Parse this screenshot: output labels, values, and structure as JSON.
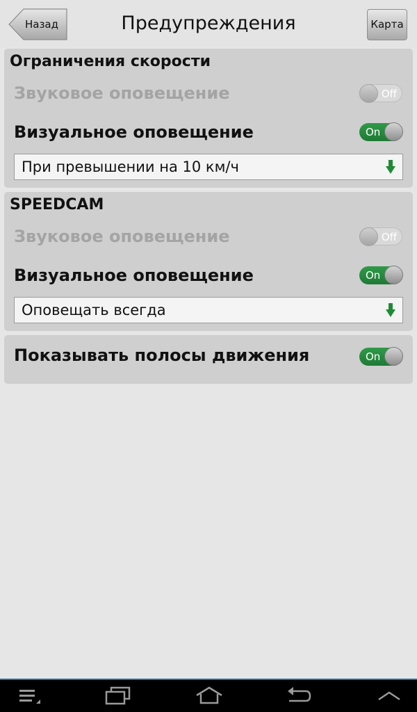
{
  "header": {
    "back_label": "Назад",
    "title": "Предупреждения",
    "map_label": "Карта"
  },
  "speed_limits": {
    "title": "Ограничения скорости",
    "sound": {
      "label": "Звуковое оповещение",
      "state": "Off",
      "enabled": false
    },
    "visual": {
      "label": "Визуальное оповещение",
      "state": "On",
      "enabled": true
    },
    "dropdown_value": "При превышении на 10 км/ч"
  },
  "speedcam": {
    "title": "SPEEDCAM",
    "sound": {
      "label": "Звуковое оповещение",
      "state": "Off",
      "enabled": false
    },
    "visual": {
      "label": "Визуальное оповещение",
      "state": "On",
      "enabled": true
    },
    "dropdown_value": "Оповещать всегда"
  },
  "lanes": {
    "label": "Показывать полосы движения",
    "state": "On"
  },
  "colors": {
    "toggle_on": "#2f9a48",
    "dropdown_arrow": "#1e8a35",
    "nav_accent": "#2a6c9a"
  },
  "icons": {
    "nav": [
      "menu-icon",
      "recent-apps-icon",
      "home-icon",
      "back-icon",
      "chevron-up-icon"
    ]
  }
}
